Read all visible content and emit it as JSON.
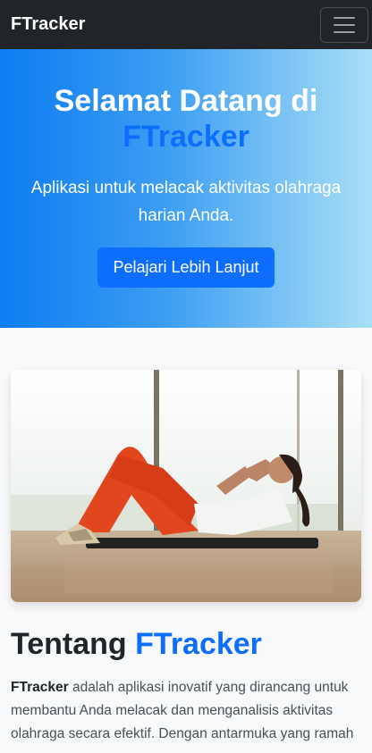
{
  "navbar": {
    "brand": "FTracker",
    "toggler_icon": "hamburger-icon"
  },
  "hero": {
    "title_prefix": "Selamat Datang di",
    "title_brand": "FTracker",
    "subtitle": "Aplikasi untuk melacak aktivitas olahraga harian Anda.",
    "button_label": "Pelajari Lebih Lanjut"
  },
  "about": {
    "title_prefix": "Tentang",
    "title_brand": "FTracker",
    "brand_bold": "FTracker",
    "description": " adalah aplikasi inovatif yang dirancang untuk membantu Anda melacak dan menganalisis aktivitas olahraga secara efektif. Dengan antarmuka yang ramah"
  },
  "colors": {
    "navbar_bg": "#212529",
    "primary": "#0d6efd",
    "hero_gradient_start": "#0d7cf2",
    "hero_gradient_end": "#a9dff5"
  }
}
